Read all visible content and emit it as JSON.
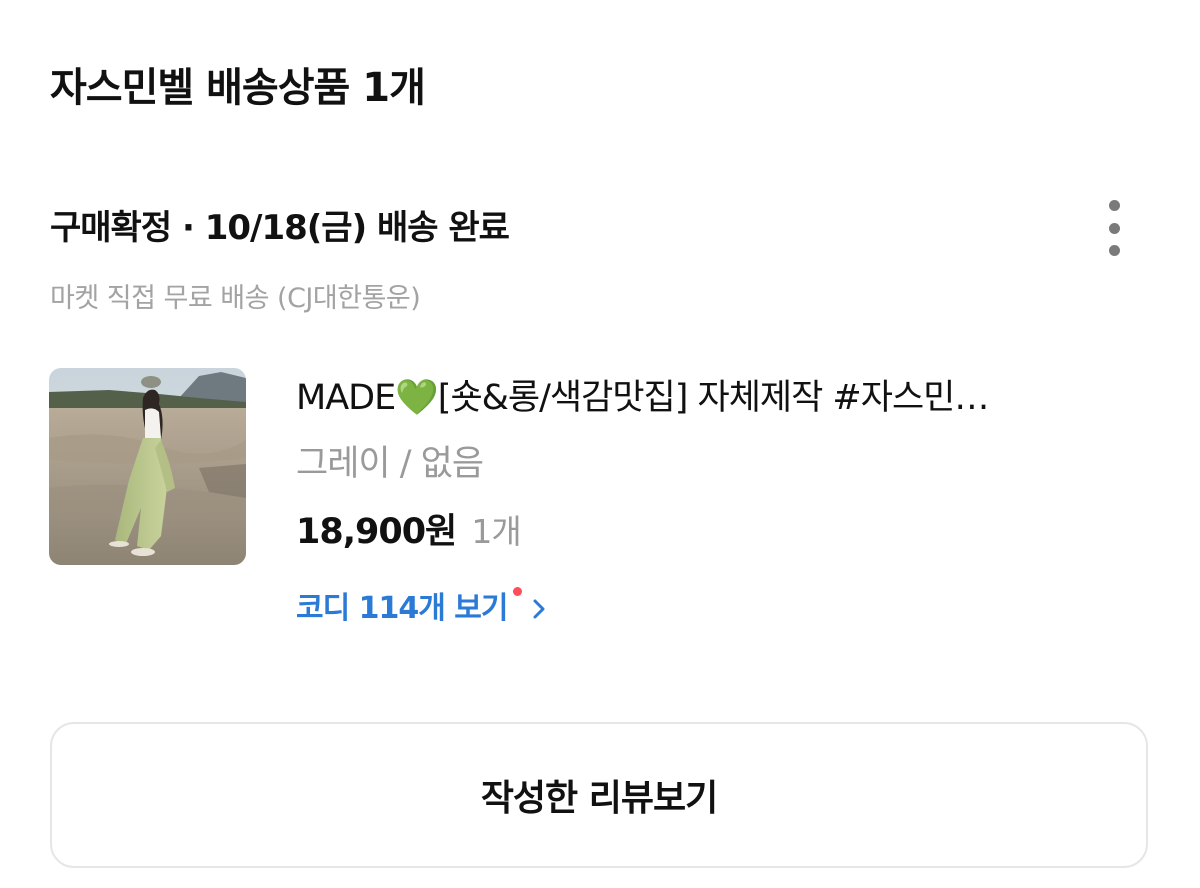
{
  "header": {
    "title": "자스민벨 배송상품 1개"
  },
  "order": {
    "status": "구매확정 · 10/18(금) 배송 완료",
    "shipping_method": "마켓 직접 무료 배송 (CJ대한통운)",
    "more_icon": "more-vertical-icon"
  },
  "product": {
    "name": "MADE💚[숏&롱/색감맛집] 자체제작 #자스민…",
    "option": "그레이 / 없음",
    "price": "18,900원",
    "quantity": "1개",
    "coordi_link_label": "코디 114개 보기",
    "coordi_link_color": "#2a7ad6",
    "new_indicator_color": "#ff4d5a"
  },
  "actions": {
    "review_button_label": "작성한 리뷰보기"
  }
}
